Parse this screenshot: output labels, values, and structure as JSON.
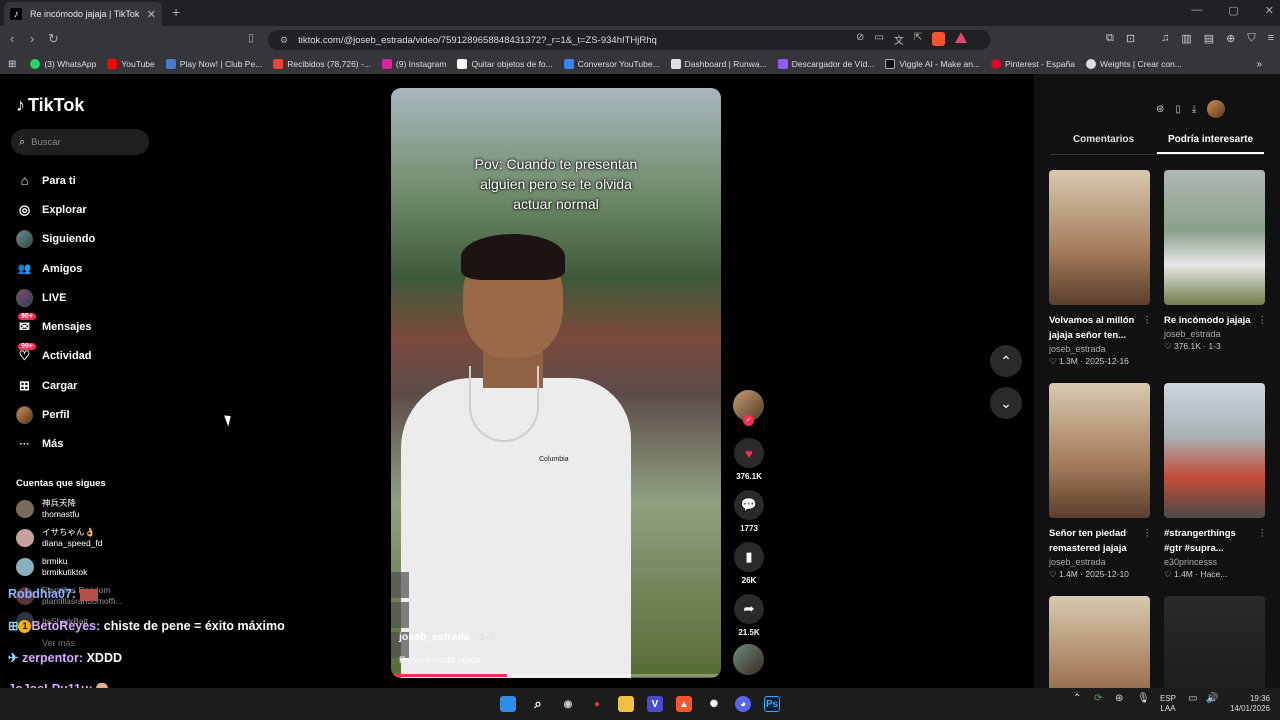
{
  "browser": {
    "tab_title": "Re incómodo jajaja | TikTok",
    "url": "tiktok.com/@joseb_estrada/video/7591289658848431372?_r=1&_t=ZS-934hITHjRhq",
    "bookmarks": [
      {
        "label": "(3) WhatsApp",
        "color": "#25d366"
      },
      {
        "label": "YouTube",
        "color": "#ff0000"
      },
      {
        "label": "Play Now! | Club Pe...",
        "color": "#4a7bd0"
      },
      {
        "label": "Recibidos (78,726) -...",
        "color": "#ea4335"
      },
      {
        "label": "(9) Instagram",
        "color": "#d6249f"
      },
      {
        "label": "Quitar objetos de fo...",
        "color": "#ffffff"
      },
      {
        "label": "Conversor YouTube...",
        "color": "#3b82f6"
      },
      {
        "label": "Dashboard | Runwa...",
        "color": "#dddddd"
      },
      {
        "label": "Descargador de Víd...",
        "color": "#8b5cf6"
      },
      {
        "label": "Viggle AI - Make an...",
        "color": "#111111"
      },
      {
        "label": "Pinterest - España",
        "color": "#e60023"
      },
      {
        "label": "Weights | Crear con...",
        "color": "#dddddd"
      }
    ]
  },
  "sidebar": {
    "logo": "TikTok",
    "search_placeholder": "Buscar",
    "menu": [
      {
        "label": "Para ti",
        "icon": "home-icon",
        "glyph": "⌂"
      },
      {
        "label": "Explorar",
        "icon": "compass-icon",
        "glyph": "◎"
      },
      {
        "label": "Siguiendo",
        "icon": "following-avatar-icon",
        "glyph": ""
      },
      {
        "label": "Amigos",
        "icon": "friends-icon",
        "glyph": "👥"
      },
      {
        "label": "LIVE",
        "icon": "live-avatar-icon",
        "glyph": ""
      },
      {
        "label": "Mensajes",
        "icon": "messages-icon",
        "glyph": "✉",
        "badge": "99+"
      },
      {
        "label": "Actividad",
        "icon": "activity-icon",
        "glyph": "♡",
        "badge": "99+"
      },
      {
        "label": "Cargar",
        "icon": "upload-icon",
        "glyph": "⊞"
      },
      {
        "label": "Perfil",
        "icon": "profile-avatar-icon",
        "glyph": ""
      },
      {
        "label": "Más",
        "icon": "more-icon",
        "glyph": "···"
      }
    ],
    "follows_heading": "Cuentas que sigues",
    "follows": [
      {
        "name": "神兵天降",
        "handle": "thomastfu",
        "color": "#7a6a5a"
      },
      {
        "name": "イサちゃん👌",
        "handle": "diana_speed_fd",
        "color": "#c8a0a0"
      },
      {
        "name": "brmiku",
        "handle": "brmikutiktok",
        "color": "#8ab0c0"
      },
      {
        "name": "Plantillas Random",
        "handle": "plantillasrandomoffi...",
        "color": "#a06060"
      },
      {
        "name": "ItsSharkBait",
        "handle": "",
        "color": "#506070"
      }
    ],
    "see_more": "Ver más"
  },
  "video": {
    "caption_lines": [
      "Pov: Cuando te presentan",
      "alguien pero se te olvida",
      "actuar normal"
    ],
    "shirt_brand": "Columbia",
    "username": "joseb_estrada",
    "date": "· 1-3",
    "description": "Re incómodo jajaja",
    "progress": 0.35
  },
  "actions": {
    "likes": "376.1K",
    "comments": "1773",
    "saves": "26K",
    "shares": "21.5K"
  },
  "right_panel": {
    "tabs": [
      "Comentarios",
      "Podría interesarte"
    ],
    "cards": [
      {
        "title1": "Volvamos al millón",
        "title2": "jajaja señor ten...",
        "user": "joseb_estrada",
        "stats": "♡ 1.3M  ·  2025-12-16"
      },
      {
        "title1": "Re incómodo jajaja",
        "title2": "",
        "user": "joseb_estrada",
        "stats": "♡ 376.1K  ·  1-3"
      },
      {
        "title1": "Señor ten piedad",
        "title2": "remastered jajaja",
        "user": "joseb_estrada",
        "stats": "♡ 1.4M  ·  2025-12-10"
      },
      {
        "title1": "#strangerthings",
        "title2": "#gtr #supra...",
        "user": "e30princesss",
        "stats": "♡ 1.4M  ·  Hace..."
      }
    ]
  },
  "chat": [
    {
      "name": "Robdhia07:",
      "message": "",
      "color": "#8fb4ff"
    },
    {
      "name": "BetoReyes:",
      "message": "chiste de pene = éxito máximo",
      "color": "#d7a8ff"
    },
    {
      "name": "zerpentor:",
      "message": "XDDD",
      "color": "#d7a8ff"
    },
    {
      "name": "JoJoeLPu11u:",
      "message": "",
      "color": "#d7a8ff"
    }
  ],
  "taskbar": {
    "lang1": "ESP",
    "lang2": "LAA",
    "time": "19:36",
    "date": "14/01/2026"
  }
}
